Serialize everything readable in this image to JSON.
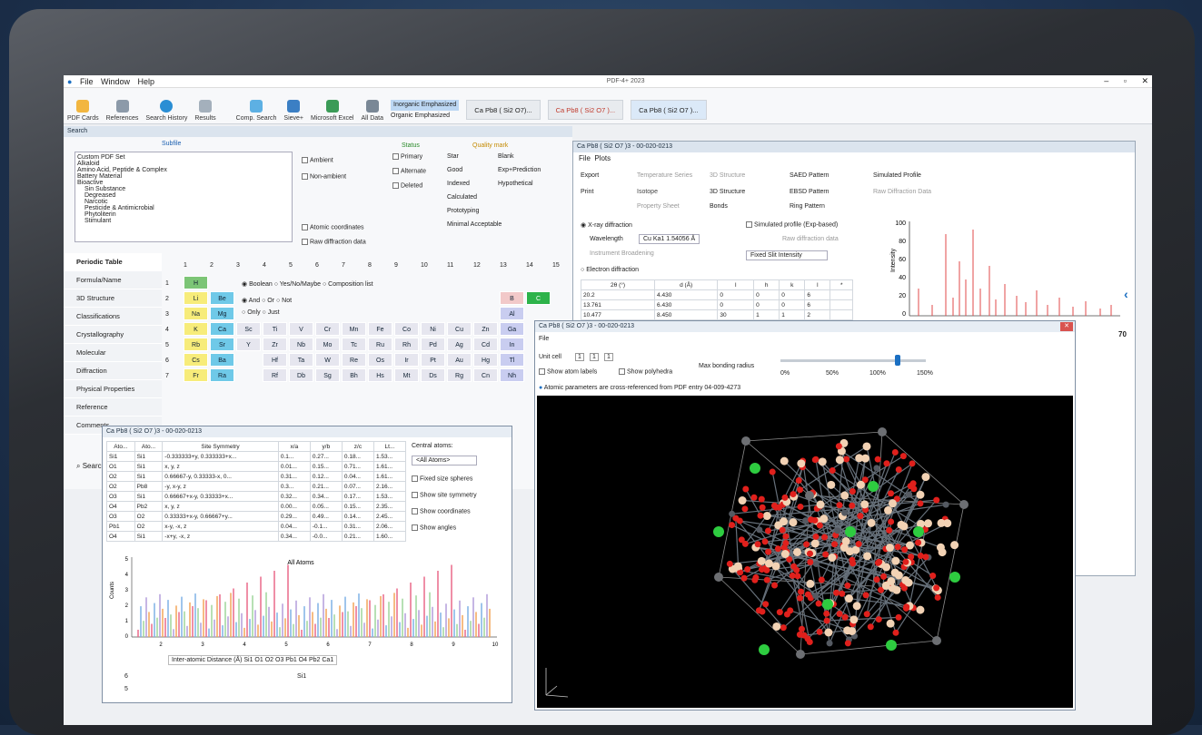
{
  "titlebar": {
    "menu": [
      "File",
      "Window",
      "Help"
    ],
    "title": "PDF-4+ 2023",
    "controls": [
      "–",
      "▫",
      "✕"
    ]
  },
  "ribbon": {
    "buttons": [
      "PDF Cards",
      "References",
      "Search History",
      "Results",
      "Comp. Search",
      "Sieve+",
      "Microsoft Excel",
      "All Data"
    ],
    "option_inorganic": "Inorganic Emphasized",
    "option_organic": "Organic Emphasized",
    "doc_tabs": [
      "Ca Pb8 ( Si2 O7)...",
      "Ca Pb8 ( Si2 O7 )...",
      "Ca Pb8 ( Si2 O7 )..."
    ]
  },
  "search": {
    "title": "Search",
    "subfiles_label": "Subfile",
    "subfiles": [
      "Custom PDF Set",
      "Alkaloid",
      "Amino Acid, Peptide & Complex",
      "Battery Material",
      "Bioactive",
      "Sin Substance",
      "Degreased",
      "Narcotic",
      "Pesticide & Antimicrobial",
      "Phytoliterin",
      "Stimulant"
    ],
    "options": [
      "Ambient",
      "Non-ambient",
      "Atomic coordinates",
      "Raw diffraction data"
    ],
    "status_title": "Status",
    "status": [
      "Primary",
      "Alternate",
      "Deleted"
    ],
    "quality_title": "Quality mark",
    "quality": [
      "Star",
      "Good",
      "Indexed",
      "Calculated",
      "Prototyping",
      "Minimal Acceptable"
    ],
    "quality2": [
      "Blank",
      "Exp+Prediction",
      "Hypothetical"
    ],
    "nav": [
      "Periodic Table",
      "Formula/Name",
      "3D Structure",
      "Classifications",
      "Crystallography",
      "Molecular",
      "Diffraction",
      "Physical Properties",
      "Reference",
      "Comments"
    ],
    "logic": "Boolean",
    "logic2": "Yes/No/Maybe",
    "logic3": "Composition list",
    "bool": [
      "And",
      "Or",
      "Not"
    ],
    "bool2": [
      "Only",
      "Just"
    ],
    "group_nums": [
      "1",
      "2",
      "3",
      "4",
      "5",
      "6",
      "7",
      "8",
      "9",
      "10",
      "11",
      "12",
      "13",
      "14",
      "15"
    ],
    "periods": [
      "1",
      "2",
      "3",
      "4",
      "5",
      "6",
      "7"
    ],
    "search_btn": "Search"
  },
  "elements": [
    [
      "H",
      0,
      0,
      "#7cc576"
    ],
    [
      "Li",
      0,
      1,
      "#f7ec7a"
    ],
    [
      "Be",
      1,
      1,
      "#6fc9e8"
    ],
    [
      "Na",
      0,
      2,
      "#f7ec7a"
    ],
    [
      "Mg",
      1,
      2,
      "#6fc9e8"
    ],
    [
      "K",
      0,
      3,
      "#f7ec7a"
    ],
    [
      "Ca",
      1,
      3,
      "#6fc9e8"
    ],
    [
      "Sc",
      2,
      3,
      "#e6e6ef"
    ],
    [
      "Ti",
      3,
      3,
      "#e6e6ef"
    ],
    [
      "V",
      4,
      3,
      "#e6e6ef"
    ],
    [
      "Cr",
      5,
      3,
      "#e6e6ef"
    ],
    [
      "Mn",
      6,
      3,
      "#e6e6ef"
    ],
    [
      "Fe",
      7,
      3,
      "#e6e6ef"
    ],
    [
      "Co",
      8,
      3,
      "#e6e6ef"
    ],
    [
      "Ni",
      9,
      3,
      "#e6e6ef"
    ],
    [
      "Cu",
      10,
      3,
      "#e6e6ef"
    ],
    [
      "Zn",
      11,
      3,
      "#e6e6ef"
    ],
    [
      "Ga",
      12,
      3,
      "#c9cdf0"
    ],
    [
      "Rb",
      0,
      4,
      "#f7ec7a"
    ],
    [
      "Sr",
      1,
      4,
      "#6fc9e8"
    ],
    [
      "Y",
      2,
      4,
      "#e6e6ef"
    ],
    [
      "Zr",
      3,
      4,
      "#e6e6ef"
    ],
    [
      "Nb",
      4,
      4,
      "#e6e6ef"
    ],
    [
      "Mo",
      5,
      4,
      "#e6e6ef"
    ],
    [
      "Tc",
      6,
      4,
      "#e6e6ef"
    ],
    [
      "Ru",
      7,
      4,
      "#e6e6ef"
    ],
    [
      "Rh",
      8,
      4,
      "#e6e6ef"
    ],
    [
      "Pd",
      9,
      4,
      "#e6e6ef"
    ],
    [
      "Ag",
      10,
      4,
      "#e6e6ef"
    ],
    [
      "Cd",
      11,
      4,
      "#e6e6ef"
    ],
    [
      "In",
      12,
      4,
      "#c9cdf0"
    ],
    [
      "Cs",
      0,
      5,
      "#f7ec7a"
    ],
    [
      "Ba",
      1,
      5,
      "#6fc9e8"
    ],
    [
      "Hf",
      3,
      5,
      "#e6e6ef"
    ],
    [
      "Ta",
      4,
      5,
      "#e6e6ef"
    ],
    [
      "W",
      5,
      5,
      "#e6e6ef"
    ],
    [
      "Re",
      6,
      5,
      "#e6e6ef"
    ],
    [
      "Os",
      7,
      5,
      "#e6e6ef"
    ],
    [
      "Ir",
      8,
      5,
      "#e6e6ef"
    ],
    [
      "Pt",
      9,
      5,
      "#e6e6ef"
    ],
    [
      "Au",
      10,
      5,
      "#e6e6ef"
    ],
    [
      "Hg",
      11,
      5,
      "#e6e6ef"
    ],
    [
      "Tl",
      12,
      5,
      "#c9cdf0"
    ],
    [
      "Fr",
      0,
      6,
      "#f7ec7a"
    ],
    [
      "Ra",
      1,
      6,
      "#6fc9e8"
    ],
    [
      "Rf",
      3,
      6,
      "#e6e6ef"
    ],
    [
      "Db",
      4,
      6,
      "#e6e6ef"
    ],
    [
      "Sg",
      5,
      6,
      "#e6e6ef"
    ],
    [
      "Bh",
      6,
      6,
      "#e6e6ef"
    ],
    [
      "Hs",
      7,
      6,
      "#e6e6ef"
    ],
    [
      "Mt",
      8,
      6,
      "#e6e6ef"
    ],
    [
      "Ds",
      9,
      6,
      "#e6e6ef"
    ],
    [
      "Rg",
      10,
      6,
      "#e6e6ef"
    ],
    [
      "Cn",
      11,
      6,
      "#e6e6ef"
    ],
    [
      "Nh",
      12,
      6,
      "#c9cdf0"
    ],
    [
      "B",
      12,
      1,
      "#f2c9c9"
    ],
    [
      "Al",
      12,
      2,
      "#c9cdf0"
    ],
    [
      "C",
      13,
      1,
      "#2db34a"
    ]
  ],
  "card": {
    "title": "Ca Pb8 ( Si2 O7 )3 - 00-020-0213",
    "menu": [
      "File",
      "Plots"
    ],
    "toolbar": [
      "Export",
      "Print",
      "Temperature Series",
      "Isotope",
      "Property Sheet",
      "3D Structure",
      "3D Structure",
      "Bonds",
      "SAED Pattern",
      "EBSD Pattern",
      "Ring Pattern",
      "Simulated Profile",
      "Raw Diffraction Data"
    ],
    "xray_label": "X-ray diffraction",
    "wavelength_label": "Wavelength",
    "wavelength_value": "Cu Ka1 1.54056 Å",
    "instrument": "Instrument Broadening",
    "fixed_slit": "Fixed Slit Intensity",
    "sim_profile": "Simulated profile (Exp-based)",
    "raw_data": "Raw diffraction data",
    "electron_label": "Electron diffraction",
    "cols": [
      "2θ (°)",
      "d (Å)",
      "I",
      "h",
      "k",
      "l",
      "*"
    ],
    "rows": [
      [
        "20.2",
        "4.430",
        "0",
        "0",
        "0",
        "6",
        ""
      ],
      [
        "13.761",
        "6.430",
        "0",
        "0",
        "0",
        "6",
        ""
      ],
      [
        "10.477",
        "8.450",
        "30",
        "1",
        "1",
        "2",
        ""
      ]
    ],
    "ylabel": "Intensity",
    "yticks": [
      "100",
      "80",
      "60",
      "40",
      "20",
      "0"
    ],
    "xticks_right": [
      "70"
    ]
  },
  "structure": {
    "title": "Ca Pb8 ( Si2 O7 )3 - 00-020-0213",
    "menu": "File",
    "unit_cell_label": "Unit cell",
    "cell": [
      "1",
      "1",
      "1"
    ],
    "show_labels": "Show atom labels",
    "show_poly": "Show polyhedra",
    "bond_label": "Max bonding radius",
    "bond_ticks": [
      "0%",
      "50%",
      "100%",
      "150%"
    ],
    "info": "Atomic parameters are cross-referenced from PDF entry 04-009-4273"
  },
  "atoms": {
    "title": "Ca Pb8 ( Si2 O7 )3 - 00-020-0213",
    "cols": [
      "Ato...",
      "Ato...",
      "Site Symmetry",
      "x/a",
      "y/b",
      "z/c",
      "Lt..."
    ],
    "rows": [
      [
        "Si1",
        "Si1",
        "-0.333333+y, 0.333333+x...",
        "0.1...",
        "0.27...",
        "0.18...",
        "1.53..."
      ],
      [
        "O1",
        "Si1",
        "x, y, z",
        "0.01...",
        "0.15...",
        "0.71...",
        "1.61..."
      ],
      [
        "O2",
        "Si1",
        "0.66667-y, 0.33333-x, 0...",
        "0.31...",
        "0.12...",
        "0.04...",
        "1.61..."
      ],
      [
        "O2",
        "Pb8",
        "-y, x-y, z",
        "0.3...",
        "0.21...",
        "0.07...",
        "2.16..."
      ],
      [
        "O3",
        "Si1",
        "0.66667+x-y, 0.33333+x...",
        "0.32...",
        "0.34...",
        "0.17...",
        "1.53..."
      ],
      [
        "O4",
        "Pb2",
        "x, y, z",
        "0.00...",
        "0.05...",
        "0.15...",
        "2.35..."
      ],
      [
        "O3",
        "O2",
        "0.33333+x-y, 0.66667+y...",
        "0.29...",
        "0.49...",
        "0.14...",
        "2.45..."
      ],
      [
        "Pb1",
        "O2",
        "x-y, -x, z",
        "0.04...",
        "-0.1...",
        "0.31...",
        "2.06..."
      ],
      [
        "O4",
        "Si1",
        "-x+y, -x, z",
        "0.34...",
        "-0.0...",
        "0.21...",
        "1.60..."
      ]
    ],
    "central_label": "Central atoms:",
    "central_value": "<All Atoms>",
    "opts": [
      "Fixed size spheres",
      "Show site symmetry",
      "Show coordinates",
      "Show angles"
    ],
    "chart_title": "All Atoms",
    "chart_xlabel": "Inter-atomic Distance (Å)",
    "legend": "Si1 O1 O2 O3 Pb1 O4 Pb2 Ca1",
    "yticks": [
      "5",
      "4",
      "3",
      "2",
      "1",
      "0"
    ],
    "xticks": [
      "2",
      "3",
      "4",
      "5",
      "6",
      "7",
      "8",
      "9",
      "10"
    ],
    "lower_ticks": [
      "6",
      "5"
    ],
    "lower_title": "Si1",
    "ylabel": "Counts"
  }
}
